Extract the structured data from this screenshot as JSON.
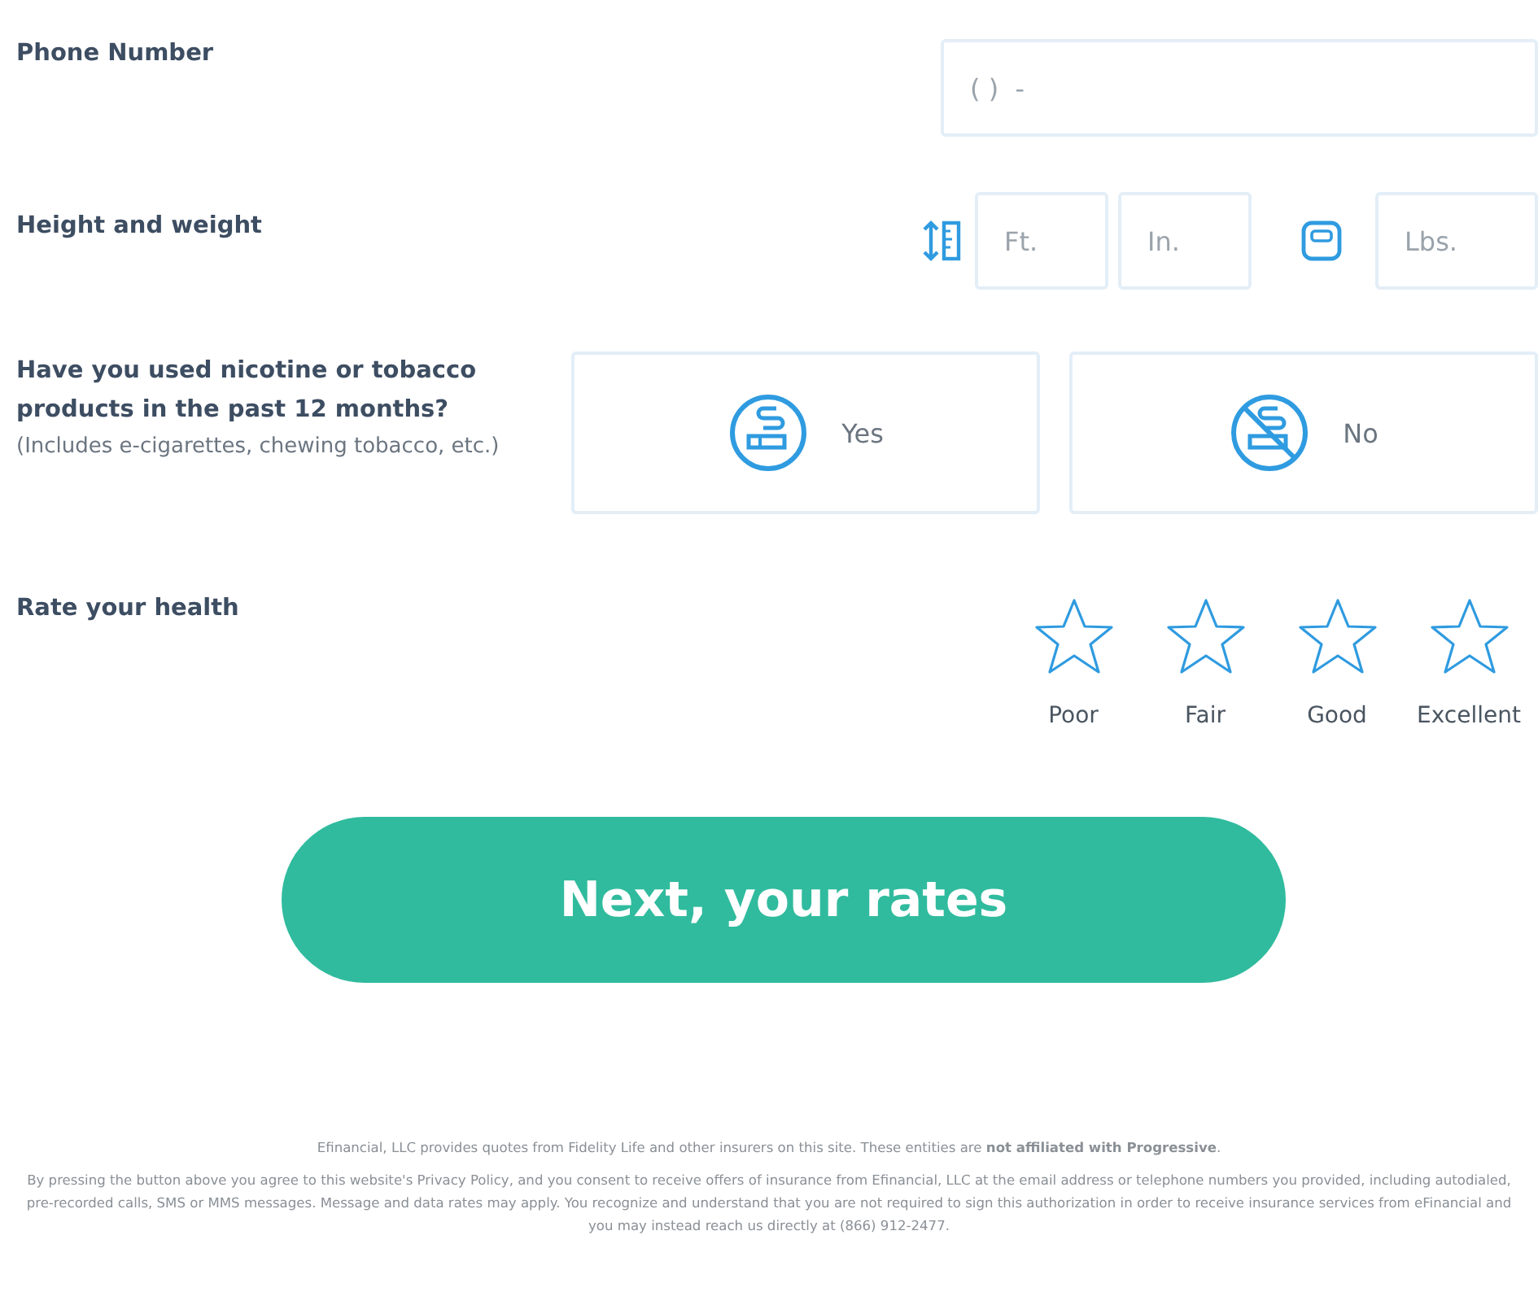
{
  "phone": {
    "label": "Phone Number",
    "placeholder": "( )  -"
  },
  "height_weight": {
    "label": "Height and weight",
    "feet_placeholder": "Ft.",
    "inches_placeholder": "In.",
    "pounds_placeholder": "Lbs."
  },
  "nicotine": {
    "question": "Have you used nicotine or tobacco products in the past 12 months?",
    "note": "(Includes e-cigarettes, chewing tobacco, etc.)",
    "options": [
      {
        "kind": "yes",
        "label": "Yes",
        "selected": false
      },
      {
        "kind": "no",
        "label": "No",
        "selected": false
      }
    ]
  },
  "health": {
    "label": "Rate your health",
    "stars": 0,
    "levels": [
      "Poor",
      "Fair",
      "Good",
      "Excellent"
    ]
  },
  "next_button": "Next, your rates",
  "footer": {
    "disclaimer": "Efinancial, LLC provides quotes from Fidelity Life and other insurers on this site. These entities are **not affiliated with Progressive**.",
    "consent": "By pressing the button above you agree to this website's Privacy Policy, and you consent to receive offers of insurance from Efinancial, LLC at the email address or telephone numbers you provided, including autodialed, pre-recorded calls, SMS or MMS messages. Message and data rates may apply. You recognize and understand that you are not required to sign this authorization in order to receive insurance services from eFinancial and you may instead reach us directly at (866) 912-2477."
  }
}
